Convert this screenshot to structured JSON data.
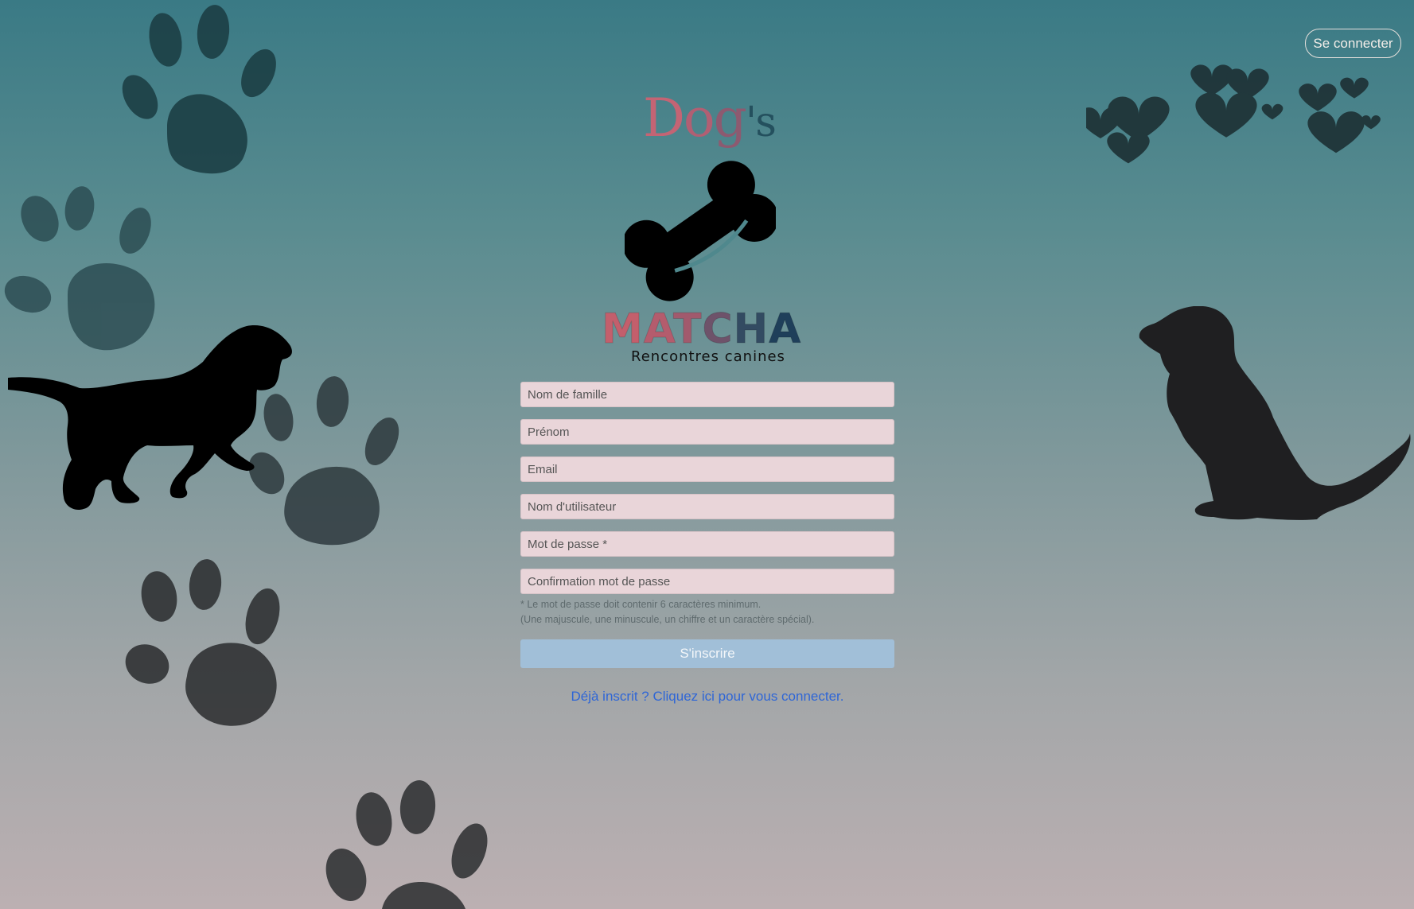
{
  "header": {
    "login_button": "Se connecter"
  },
  "brand": {
    "logo_top": "Dog's",
    "logo_top_parts": [
      "D",
      "o",
      "g",
      "'s"
    ],
    "logo_main_letters": [
      "M",
      "A",
      "T",
      "C",
      "H",
      "A"
    ],
    "tagline": "Rencontres canines"
  },
  "form": {
    "last_name_placeholder": "Nom de famille",
    "first_name_placeholder": "Prénom",
    "email_placeholder": "Email",
    "username_placeholder": "Nom d'utilisateur",
    "password_placeholder": "Mot de passe *",
    "confirm_placeholder": "Confirmation mot de passe",
    "hint_line1": "* Le mot de passe doit contenir 6 caractères minimum.",
    "hint_line2": "(Une majuscule, une minuscule, un chiffre et un caractère spécial).",
    "submit_label": "S'inscrire"
  },
  "footer": {
    "signin_link": "Déjà inscrit ? Cliquez ici pour vous connecter."
  },
  "colors": {
    "background_top": "#3a7a85",
    "background_bottom": "#bcb0b2",
    "input_background": "#e9d5d9",
    "submit_background": "#a1bfd8",
    "link": "#2f66d6"
  },
  "icons": [
    "paw-print-icon",
    "dog-silhouette-icon",
    "heart-icon",
    "bone-icon"
  ]
}
